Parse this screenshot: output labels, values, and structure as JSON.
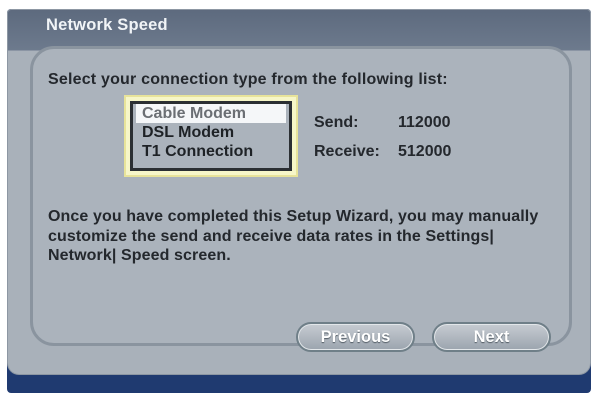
{
  "window": {
    "title": "Network Speed"
  },
  "prompt": "Select your connection type from the following list:",
  "connection_list": {
    "items": [
      "Cable Modem",
      "DSL Modem",
      "T1 Connection"
    ],
    "selected": "Cable Modem"
  },
  "rates": {
    "send_label": "Send:",
    "send_value": "112000",
    "receive_label": "Receive:",
    "receive_value": "512000"
  },
  "info_text": "Once you have completed this Setup Wizard, you may manually customize the send and receive data rates in the Settings| Network| Speed screen.",
  "buttons": {
    "previous": "Previous",
    "next": "Next"
  }
}
